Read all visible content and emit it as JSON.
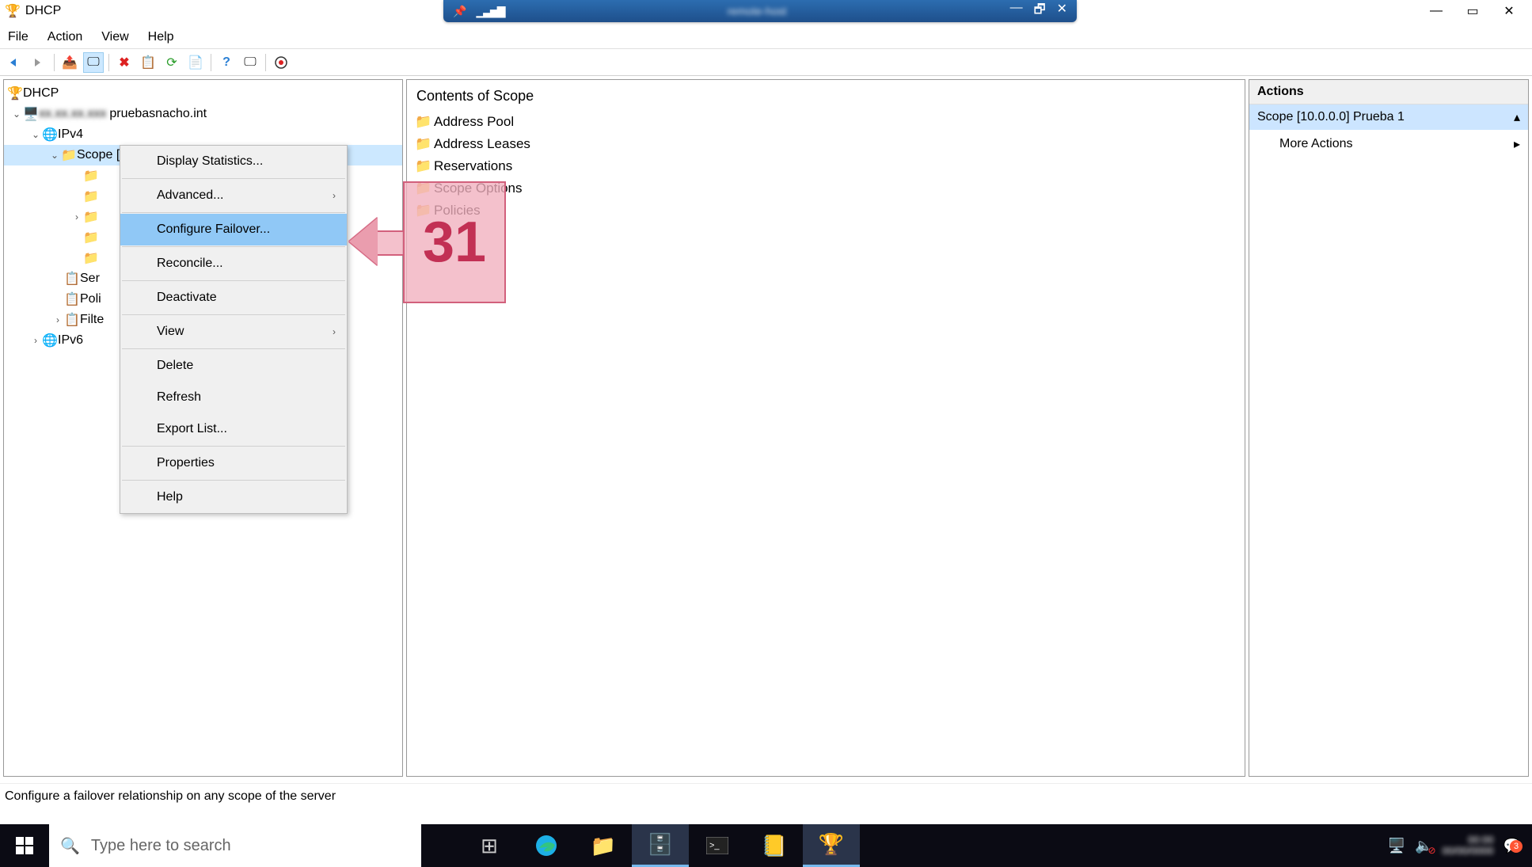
{
  "window": {
    "app_title": "DHCP"
  },
  "remote_bar": {
    "hostname": "remote-host"
  },
  "menubar": {
    "items": [
      "File",
      "Action",
      "View",
      "Help"
    ]
  },
  "tree": {
    "root": "DHCP",
    "server": "pruebasnacho.int",
    "server_blurred": "xx.xx.xx.xxx",
    "ipv4": "IPv4",
    "scope": "Scope [10.0.0.0] Prueba 1",
    "server_options": "Server Options",
    "policies": "Policies",
    "filters": "Filters",
    "ipv6": "IPv6"
  },
  "context_menu": {
    "items": [
      "Display Statistics...",
      "Advanced...",
      "Configure Failover...",
      "Reconcile...",
      "Deactivate",
      "View",
      "Delete",
      "Refresh",
      "Export List...",
      "Properties",
      "Help"
    ]
  },
  "callout": {
    "number": "31"
  },
  "content": {
    "title": "Contents of Scope",
    "items": [
      "Address Pool",
      "Address Leases",
      "Reservations",
      "Scope Options",
      "Policies"
    ]
  },
  "actions": {
    "title": "Actions",
    "scope": "Scope [10.0.0.0] Prueba 1",
    "more": "More Actions"
  },
  "statusbar": {
    "text": "Configure a failover relationship on any scope of the server"
  },
  "taskbar": {
    "search_placeholder": "Type here to search",
    "notif_count": "3"
  }
}
